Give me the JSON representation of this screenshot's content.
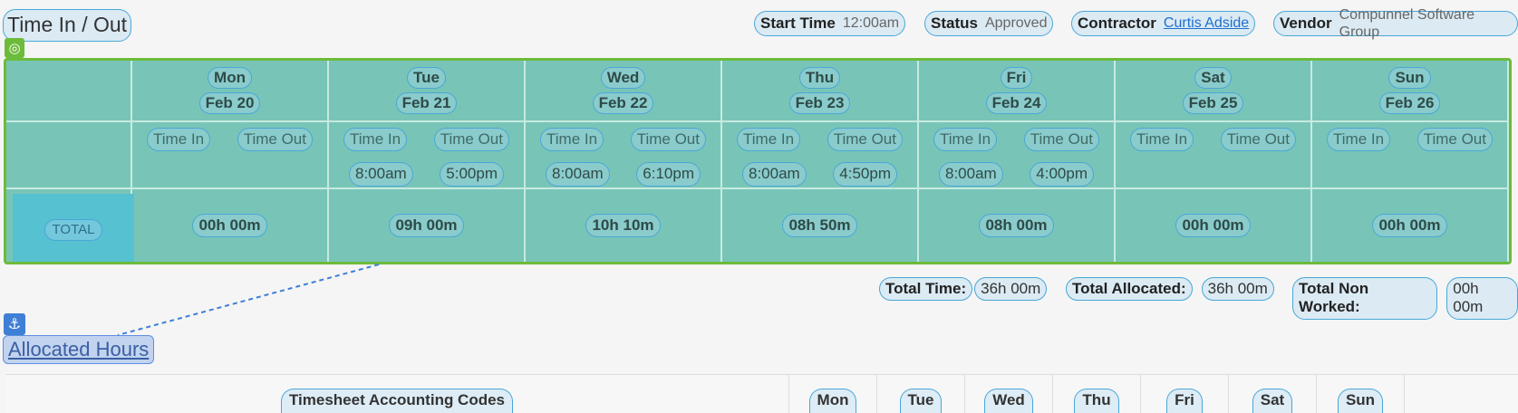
{
  "header": {
    "title": "Time In / Out",
    "start_time": {
      "label": "Start Time",
      "value": "12:00am"
    },
    "status": {
      "label": "Status",
      "value": "Approved"
    },
    "contractor": {
      "label": "Contractor",
      "value": "Curtis Adside"
    },
    "vendor": {
      "label": "Vendor",
      "value": "Compunnel Software Group"
    }
  },
  "grid": {
    "days": [
      {
        "day": "Mon",
        "date": "Feb 20",
        "time_in": "",
        "time_out": "",
        "total": "00h 00m"
      },
      {
        "day": "Tue",
        "date": "Feb 21",
        "time_in": "8:00am",
        "time_out": "5:00pm",
        "total": "09h 00m"
      },
      {
        "day": "Wed",
        "date": "Feb 22",
        "time_in": "8:00am",
        "time_out": "6:10pm",
        "total": "10h 10m"
      },
      {
        "day": "Thu",
        "date": "Feb 23",
        "time_in": "8:00am",
        "time_out": "4:50pm",
        "total": "08h 50m"
      },
      {
        "day": "Fri",
        "date": "Feb 24",
        "time_in": "8:00am",
        "time_out": "4:00pm",
        "total": "08h 00m"
      },
      {
        "day": "Sat",
        "date": "Feb 25",
        "time_in": "",
        "time_out": "",
        "total": "00h 00m"
      },
      {
        "day": "Sun",
        "date": "Feb 26",
        "time_in": "",
        "time_out": "",
        "total": "00h 00m"
      }
    ],
    "time_in_label": "Time In",
    "time_out_label": "Time Out",
    "total_label": "TOTAL"
  },
  "summary": {
    "total_time": {
      "label": "Total Time:",
      "value": "36h 00m"
    },
    "total_allocated": {
      "label": "Total Allocated:",
      "value": "36h 00m"
    },
    "total_non_worked": {
      "label": "Total Non Worked:",
      "value": "00h 00m"
    }
  },
  "allocated": {
    "title": "Allocated Hours",
    "codes_header": "Timesheet Accounting Codes",
    "days": [
      "Mon",
      "Tue",
      "Wed",
      "Thu",
      "Fri",
      "Sat",
      "Sun"
    ]
  },
  "colors": {
    "grid_bg": "#78c5b8",
    "grid_border": "#6dbb3a",
    "pill_border": "#4aa7d6",
    "link": "#1e6fd0",
    "anchor": "#3f7fd6"
  }
}
